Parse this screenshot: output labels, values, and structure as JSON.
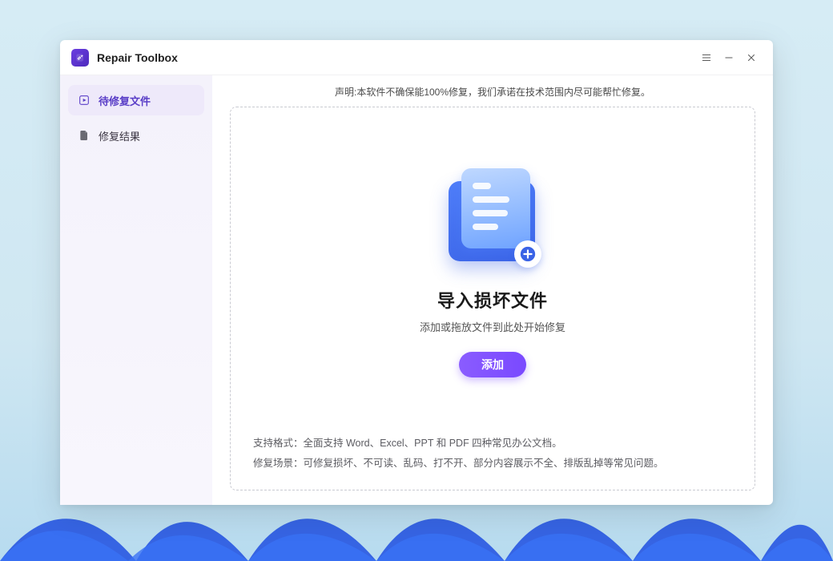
{
  "app": {
    "title": "Repair Toolbox"
  },
  "sidebar": {
    "items": [
      {
        "label": "待修复文件",
        "icon": "play-file-icon",
        "active": true
      },
      {
        "label": "修复结果",
        "icon": "file-result-icon",
        "active": false
      }
    ]
  },
  "main": {
    "disclaimer": "声明:本软件不确保能100%修复，我们承诺在技术范围内尽可能帮忙修复。",
    "import_title": "导入损坏文件",
    "import_subtitle": "添加或拖放文件到此处开始修复",
    "add_button": "添加",
    "info": {
      "formats": "支持格式：全面支持 Word、Excel、PPT 和 PDF 四种常见办公文档。",
      "scenarios": "修复场景：可修复损坏、不可读、乱码、打不开、部分内容展示不全、排版乱掉等常见问题。"
    }
  }
}
